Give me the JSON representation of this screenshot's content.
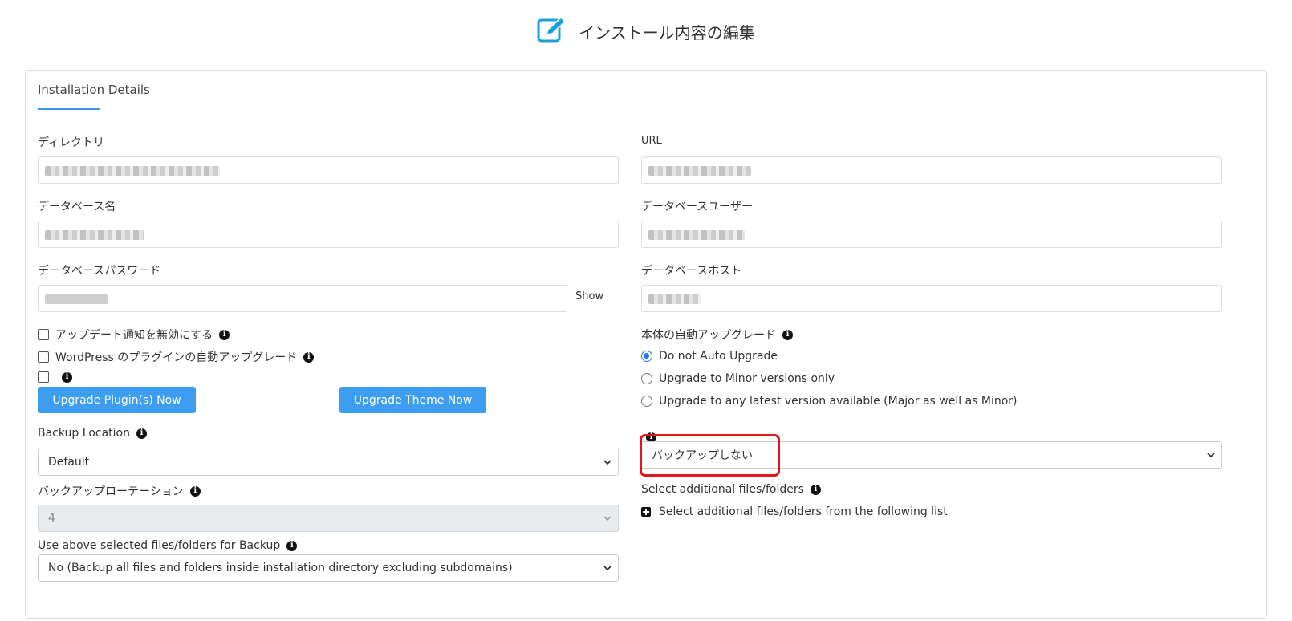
{
  "header": {
    "title": "インストール内容の編集",
    "icon": "edit-icon"
  },
  "tab": {
    "label": "Installation Details"
  },
  "colors": {
    "accent": "#3a99e6",
    "button": "#3d9df0",
    "highlight": "#e8141b",
    "radio_selected": "#1e7ce6"
  },
  "fields": {
    "directory_label": "ディレクトリ",
    "url_label": "URL",
    "db_name_label": "データベース名",
    "db_user_label": "データベースユーザー",
    "db_password_label": "データベースパスワード",
    "db_password_show": "Show",
    "db_host_label": "データベースホスト"
  },
  "checkboxes": [
    {
      "label": "アップデート通知を無効にする",
      "checked": false
    },
    {
      "label": "WordPress のプラグインの自動アップグレード",
      "checked": false
    },
    {
      "label": "",
      "checked": false
    }
  ],
  "buttons": {
    "upgrade_plugins": "Upgrade Plugin(s) Now",
    "upgrade_theme": "Upgrade Theme Now"
  },
  "auto_upgrade": {
    "label": "本体の自動アップグレード",
    "options": [
      {
        "label": "Do not Auto Upgrade",
        "selected": true
      },
      {
        "label": "Upgrade to Minor versions only",
        "selected": false
      },
      {
        "label": "Upgrade to any latest version available (Major as well as Minor)",
        "selected": false
      }
    ]
  },
  "backup": {
    "location_label": "Backup Location",
    "location_value": "Default",
    "rotation_label": "バックアップローテーション",
    "rotation_value": "4",
    "use_selected_label": "Use above selected files/folders for Backup",
    "use_selected_value": "No (Backup all files and folders inside installation directory excluding subdomains)",
    "auto_backup_value": "バックアップしない"
  },
  "additional": {
    "label": "Select additional files/folders",
    "link": "Select additional files/folders from the following list"
  }
}
